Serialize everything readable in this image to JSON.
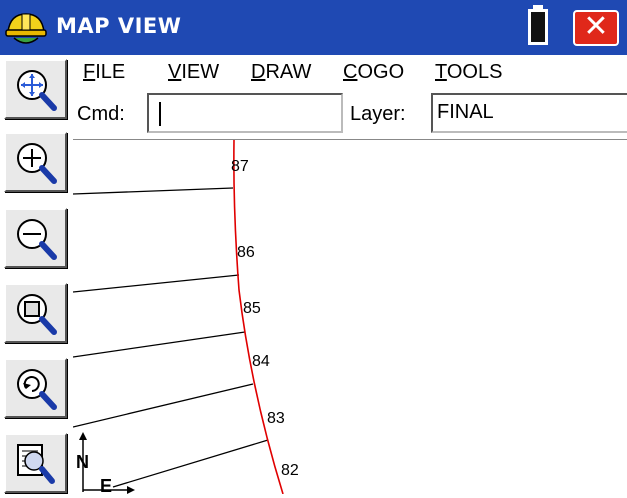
{
  "window": {
    "title": "MAP VIEW",
    "close_label": "✕"
  },
  "menu": {
    "items": [
      {
        "label": "FILE",
        "accel": "F"
      },
      {
        "label": "VIEW",
        "accel": "V"
      },
      {
        "label": "DRAW",
        "accel": "D"
      },
      {
        "label": "COGO",
        "accel": "C"
      },
      {
        "label": "TOOLS",
        "accel": "T"
      }
    ]
  },
  "command": {
    "label": "Cmd:",
    "value": ""
  },
  "layer": {
    "label": "Layer:",
    "value": "FINAL"
  },
  "toolbar": {
    "buttons": [
      {
        "name": "zoom-extents-button",
        "icon": "zoom-extents-icon"
      },
      {
        "name": "zoom-in-button",
        "icon": "zoom-in-icon"
      },
      {
        "name": "zoom-out-button",
        "icon": "zoom-out-icon"
      },
      {
        "name": "zoom-window-button",
        "icon": "zoom-window-icon"
      },
      {
        "name": "zoom-previous-button",
        "icon": "zoom-previous-icon"
      },
      {
        "name": "map-settings-button",
        "icon": "map-settings-icon"
      }
    ]
  },
  "map": {
    "points": [
      "87",
      "86",
      "85",
      "84",
      "83",
      "82"
    ],
    "north_label": "N",
    "east_label": "E",
    "line_color": "#e00000"
  }
}
